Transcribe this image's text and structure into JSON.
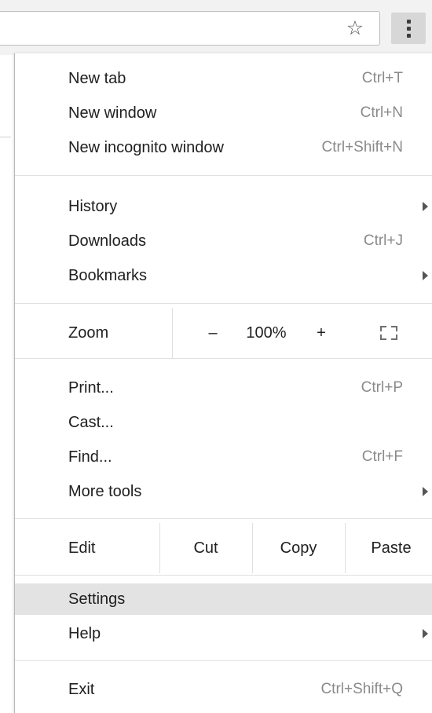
{
  "toolbar": {
    "bookmark_icon": "star-icon",
    "menu_icon": "more-vertical-icon"
  },
  "menu": {
    "group1": [
      {
        "label": "New tab",
        "shortcut": "Ctrl+T"
      },
      {
        "label": "New window",
        "shortcut": "Ctrl+N"
      },
      {
        "label": "New incognito window",
        "shortcut": "Ctrl+Shift+N"
      }
    ],
    "group2": [
      {
        "label": "History",
        "submenu": true
      },
      {
        "label": "Downloads",
        "shortcut": "Ctrl+J"
      },
      {
        "label": "Bookmarks",
        "submenu": true
      }
    ],
    "zoom": {
      "label": "Zoom",
      "minus": "–",
      "value": "100%",
      "plus": "+",
      "fullscreen_icon": "fullscreen-icon"
    },
    "group3": [
      {
        "label": "Print...",
        "shortcut": "Ctrl+P"
      },
      {
        "label": "Cast..."
      },
      {
        "label": "Find...",
        "shortcut": "Ctrl+F"
      },
      {
        "label": "More tools",
        "submenu": true
      }
    ],
    "edit": {
      "label": "Edit",
      "cut": "Cut",
      "copy": "Copy",
      "paste": "Paste"
    },
    "group4": [
      {
        "label": "Settings",
        "highlighted": true
      },
      {
        "label": "Help",
        "submenu": true
      }
    ],
    "exit": {
      "label": "Exit",
      "shortcut": "Ctrl+Shift+Q"
    }
  },
  "colors": {
    "menu_bg": "#ffffff",
    "highlight": "#e3e3e3",
    "shortcut_text": "#8a8a8a",
    "toolbar_bg": "#f2f2f2"
  }
}
